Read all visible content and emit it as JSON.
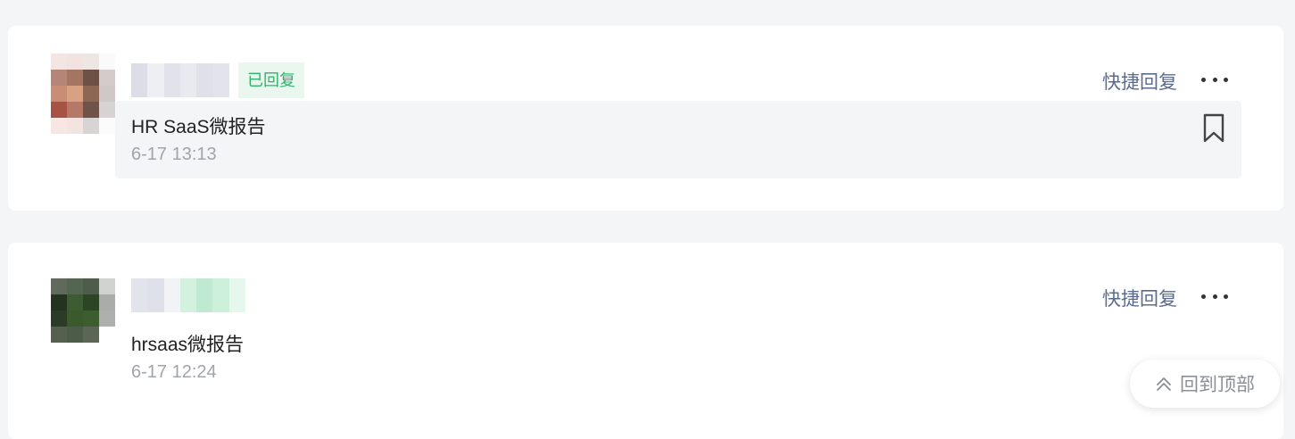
{
  "messages": [
    {
      "status_badge": "已回复",
      "title": "HR SaaS微报告",
      "time": "6-17 13:13",
      "quick_reply_label": "快捷回复",
      "more_icon": "more-horizontal-icon",
      "bookmark_icon": "bookmark-icon"
    },
    {
      "title": "hrsaas微报告",
      "time": "6-17 12:24",
      "quick_reply_label": "快捷回复",
      "more_icon": "more-horizontal-icon"
    }
  ],
  "back_to_top": {
    "label": "回到顶部",
    "icon": "double-chevron-up-icon"
  },
  "colors": {
    "page_bg": "#f4f5f7",
    "card_bg": "#ffffff",
    "badge_bg": "#e9f7ef",
    "badge_text": "#2fb36b",
    "link_text": "#5b6b8f",
    "time_text": "#a0a4ab"
  }
}
